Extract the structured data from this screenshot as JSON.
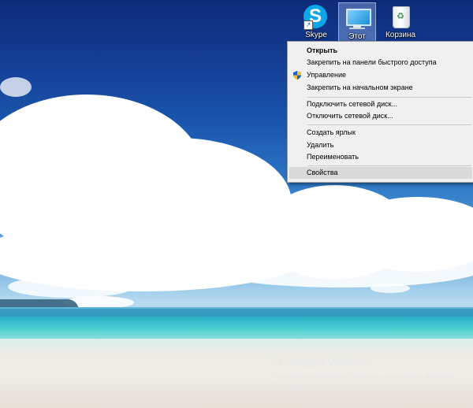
{
  "desktop_icons": [
    {
      "label": "Skype",
      "icon": "skype-icon",
      "selected": false
    },
    {
      "label": "Этот",
      "icon": "this-pc-icon",
      "selected": true
    },
    {
      "label": "Корзина",
      "icon": "recycle-bin-icon",
      "selected": false
    }
  ],
  "context_menu": {
    "items": [
      {
        "label": "Открыть",
        "bold": true
      },
      {
        "label": "Закрепить на панели быстрого доступа"
      },
      {
        "label": "Управление",
        "icon": "uac-shield-icon"
      },
      {
        "label": "Закрепить на начальном экране"
      },
      {
        "label": "Подключить сетевой диск..."
      },
      {
        "label": "Отключить сетевой диск..."
      },
      {
        "label": "Создать ярлык"
      },
      {
        "label": "Удалить"
      },
      {
        "label": "Переименовать"
      },
      {
        "label": "Свойства",
        "highlighted": true
      }
    ]
  },
  "watermark": {
    "title": "Активация Windows",
    "text": "Чтобы активировать Windows, перейдите в раздел \"Параметры\"."
  },
  "colors": {
    "skype_blue": "#0ba6e6",
    "menu_background": "#f0f0f0",
    "menu_highlight": "#dadada",
    "selection_overlay": "#b4d2ff"
  }
}
